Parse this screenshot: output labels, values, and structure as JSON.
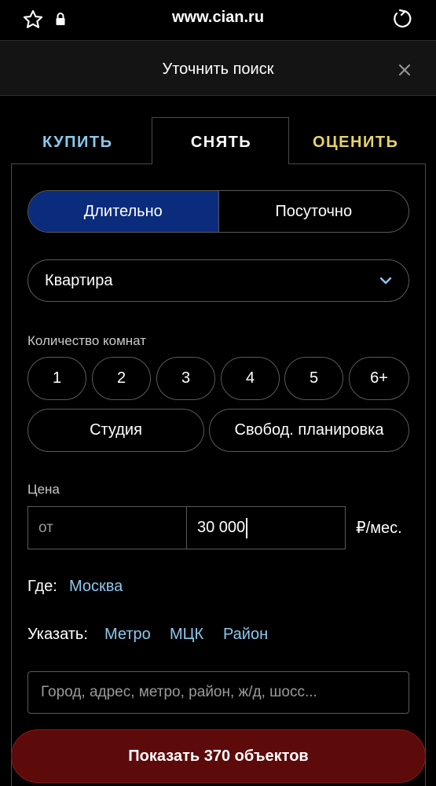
{
  "browser": {
    "url": "www.cian.ru",
    "icons": [
      "star-icon",
      "lock-icon",
      "reload-icon"
    ]
  },
  "modal": {
    "title": "Уточнить поиск",
    "close_icon": "close-icon"
  },
  "tabs": [
    {
      "label": "КУПИТЬ",
      "color": "#8cc8ee"
    },
    {
      "label": "СНЯТЬ",
      "active": true
    },
    {
      "label": "ОЦЕНИТЬ",
      "color": "#e6d36a"
    }
  ],
  "rent_type": {
    "options": [
      "Длительно",
      "Посуточно"
    ],
    "selected": "Длительно",
    "active_color": "#0b2b7c"
  },
  "property_type": {
    "selected": "Квартира",
    "icon": "chevron-down-icon"
  },
  "rooms": {
    "label": "Количество комнат",
    "options": [
      "1",
      "2",
      "3",
      "4",
      "5",
      "6+"
    ],
    "extra": [
      "Студия",
      "Свобод. планировка"
    ]
  },
  "price": {
    "label": "Цена",
    "from_placeholder": "от",
    "to_value": "30 000",
    "unit": "₽/мес."
  },
  "location": {
    "where_label": "Где:",
    "city": "Москва",
    "specify_label": "Указать:",
    "links": [
      "Метро",
      "МЦК",
      "Район"
    ],
    "search_placeholder": "Город, адрес, метро, район, ж/д, шосс..."
  },
  "submit": {
    "label": "Показать 370 объектов",
    "color": "#5c0a0a"
  }
}
